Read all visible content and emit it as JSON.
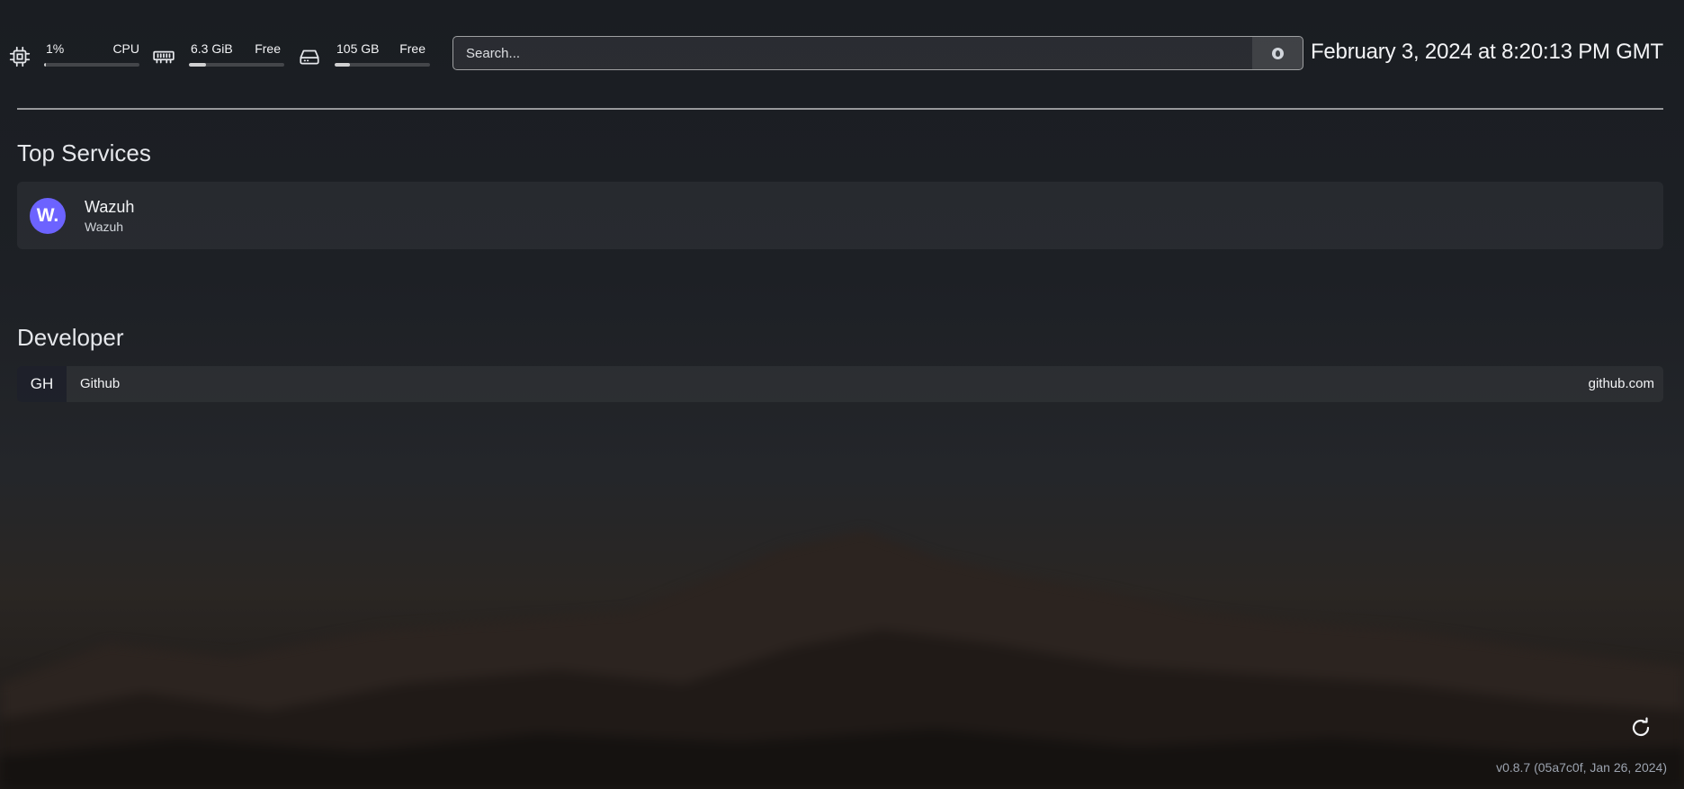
{
  "resources": {
    "cpu": {
      "icon": "cpu-icon",
      "value": "1%",
      "label": "CPU",
      "usage": 0.01
    },
    "memory": {
      "icon": "memory-icon",
      "value": "6.3 GiB",
      "label": "Free",
      "usage": 0.18
    },
    "disk": {
      "icon": "disk-icon",
      "value": "105 GB",
      "label": "Free",
      "usage": 0.16
    }
  },
  "search": {
    "placeholder": "Search...",
    "engine_icon": "duckduckgo-icon"
  },
  "datetime": "February 3, 2024 at 8:20:13 PM GMT",
  "sections": {
    "top_services": {
      "title": "Top Services",
      "items": [
        {
          "avatar": "W.",
          "name": "Wazuh",
          "description": "Wazuh",
          "color": "#6c63ff"
        }
      ]
    },
    "developer": {
      "title": "Developer",
      "bookmarks": [
        {
          "abbr": "GH",
          "name": "Github",
          "url": "github.com"
        }
      ]
    }
  },
  "footer": {
    "refresh_icon": "refresh-icon",
    "version": "v0.8.7 (05a7c0f, Jan 26, 2024)"
  }
}
